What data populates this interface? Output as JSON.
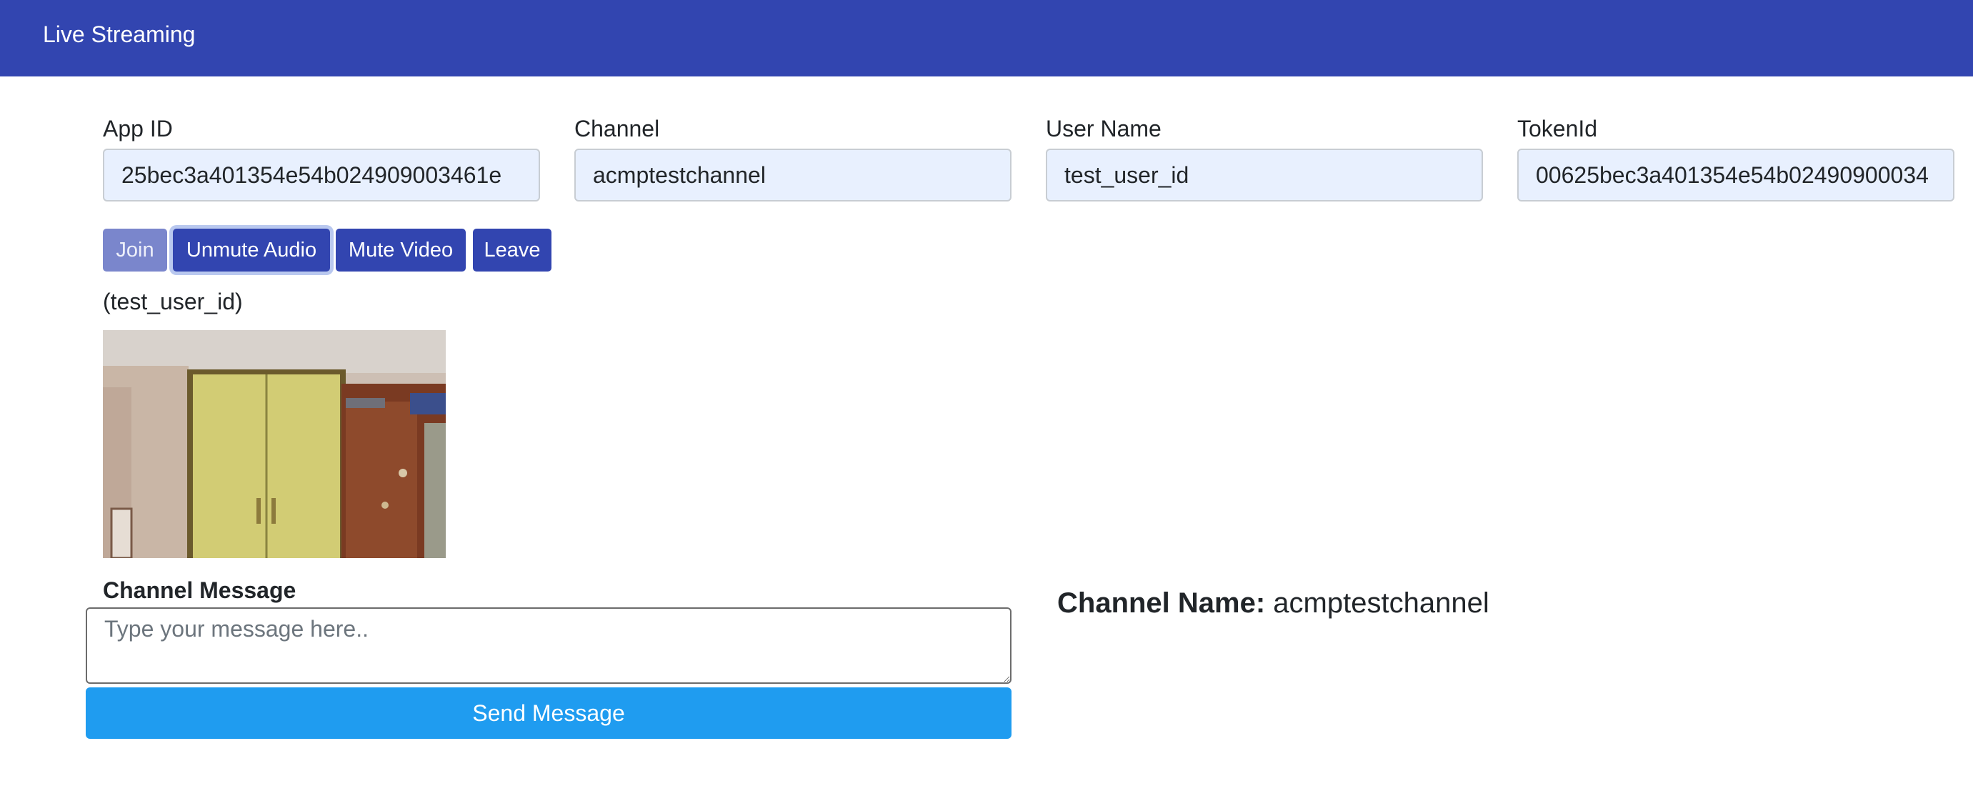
{
  "navbar": {
    "title": "Live Streaming"
  },
  "form": {
    "app_id": {
      "label": "App ID",
      "value": "25bec3a401354e54b024909003461e"
    },
    "channel": {
      "label": "Channel",
      "value": "acmptestchannel"
    },
    "user_name": {
      "label": "User Name",
      "value": "test_user_id"
    },
    "token_id": {
      "label": "TokenId",
      "value": "00625bec3a401354e54b02490900034"
    }
  },
  "controls": {
    "join": "Join",
    "unmute_audio": "Unmute Audio",
    "mute_video": "Mute Video",
    "leave": "Leave"
  },
  "local_stream": {
    "user_label": "(test_user_id)"
  },
  "message": {
    "title": "Channel Message",
    "placeholder": "Type your message here..",
    "send_label": "Send Message"
  },
  "channel_info": {
    "key": "Channel Name:",
    "value": "acmptestchannel"
  },
  "colors": {
    "navbar": "#3245b0",
    "button": "#3245b0",
    "button_disabled": "#7a86cc",
    "send_button": "#1f9cf0",
    "input_bg": "#e8f0fe"
  }
}
